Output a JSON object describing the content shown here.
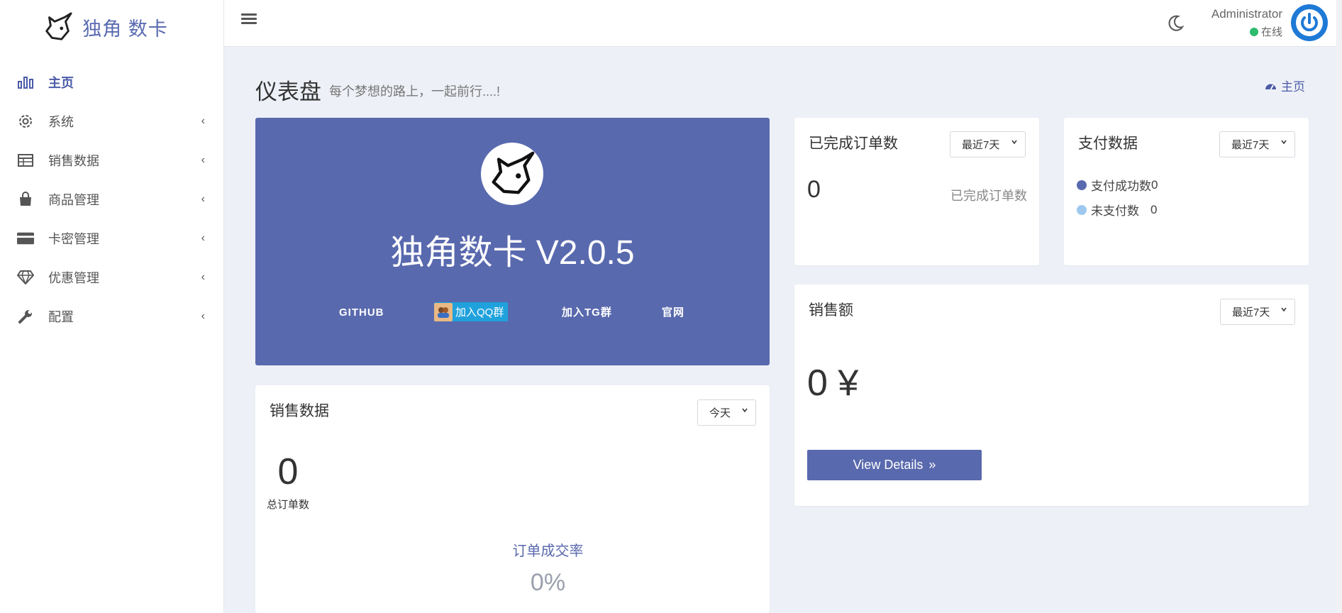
{
  "brand": {
    "name": "独角 数卡"
  },
  "sidebar": {
    "items": [
      {
        "label": "主页",
        "icon": "bar-chart-icon",
        "active": true
      },
      {
        "label": "系统",
        "icon": "gear-icon"
      },
      {
        "label": "销售数据",
        "icon": "table-icon"
      },
      {
        "label": "商品管理",
        "icon": "shopping-bag-icon"
      },
      {
        "label": "卡密管理",
        "icon": "credit-card-icon"
      },
      {
        "label": "优惠管理",
        "icon": "diamond-icon"
      },
      {
        "label": "配置",
        "icon": "wrench-icon"
      }
    ]
  },
  "topbar": {
    "user_name": "Administrator",
    "user_status": "在线"
  },
  "page": {
    "title": "仪表盘",
    "subtitle": "每个梦想的路上，一起前行....!",
    "breadcrumb": "主页"
  },
  "hero": {
    "title": "独角数卡 V2.0.5",
    "links": {
      "github": "GITHUB",
      "qq": "加入QQ群",
      "tg": "加入TG群",
      "site": "官网"
    }
  },
  "orders_card": {
    "title": "已完成订单数",
    "range": "最近7天",
    "value": "0",
    "label": "已完成订单数"
  },
  "payment_card": {
    "title": "支付数据",
    "range": "最近7天",
    "success_label": "支付成功数",
    "success_value": "0",
    "unpaid_label": "未支付数",
    "unpaid_value": "0"
  },
  "sales_amount_card": {
    "title": "销售额",
    "range": "最近7天",
    "value": "0 ¥",
    "button": "View Details"
  },
  "sales_data_card": {
    "title": "销售数据",
    "range": "今天",
    "total_value": "0",
    "total_label": "总订单数",
    "rate_label": "订单成交率",
    "rate_value": "0%"
  },
  "colors": {
    "primary": "#5969ae",
    "success_dot": "#5969ae",
    "unpaid_dot": "#9ec9ef",
    "online": "#2dbb6e"
  }
}
